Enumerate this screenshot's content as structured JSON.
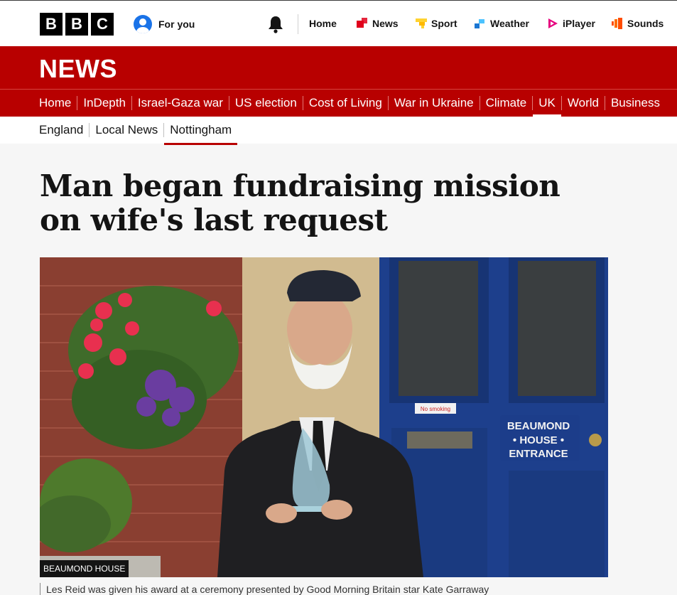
{
  "global_nav": {
    "blocks": [
      "B",
      "B",
      "C"
    ],
    "for_you": "For you",
    "links": [
      {
        "label": "Home",
        "icon": "none",
        "color": "#141414"
      },
      {
        "label": "News",
        "icon": "news-icon",
        "color": "#e0001b"
      },
      {
        "label": "Sport",
        "icon": "sport-icon",
        "color": "#ffd230"
      },
      {
        "label": "Weather",
        "icon": "weather-icon",
        "color": "#1b76d2"
      },
      {
        "label": "iPlayer",
        "icon": "iplayer-icon",
        "color": "#e6007e"
      },
      {
        "label": "Sounds",
        "icon": "sounds-icon",
        "color": "#ff4c00"
      }
    ]
  },
  "masthead": {
    "title": "NEWS",
    "color": "#b80000"
  },
  "primary_nav": {
    "items": [
      "Home",
      "InDepth",
      "Israel-Gaza war",
      "US election",
      "Cost of Living",
      "War in Ukraine",
      "Climate",
      "UK",
      "World",
      "Business"
    ],
    "active": "UK"
  },
  "secondary_nav": {
    "items": [
      "England",
      "Local News",
      "Nottingham"
    ],
    "active": "Nottingham"
  },
  "article": {
    "headline": "Man began fundraising mission on wife's last request",
    "image": {
      "copyright": "BEAUMOND HOUSE",
      "door_sign": [
        "BEAUMOND",
        "• HOUSE •",
        "ENTRANCE"
      ],
      "no_smoking": "No smoking"
    },
    "caption": "Les Reid was given his award at a ceremony presented by Good Morning Britain star Kate Garraway"
  }
}
